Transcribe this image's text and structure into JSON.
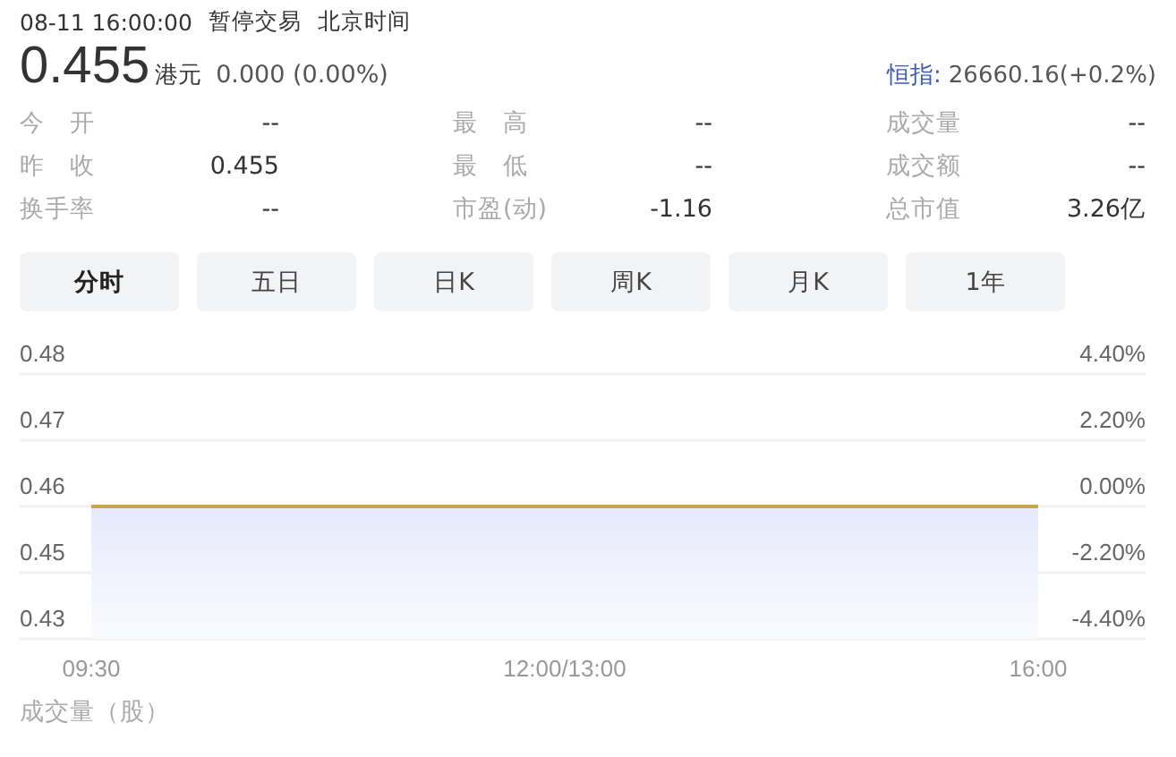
{
  "header": {
    "datetime": "08-11 16:00:00",
    "status": "暂停交易",
    "timezone": "北京时间"
  },
  "quote": {
    "price": "0.455",
    "currency": "港元",
    "change": "0.000 (0.00%)",
    "index_label": "恒指:",
    "index_value": "26660.16(+0.2%)"
  },
  "stats": [
    {
      "label": "今　开",
      "value": "--"
    },
    {
      "label": "最　高",
      "value": "--"
    },
    {
      "label": "成交量",
      "value": "--"
    },
    {
      "label": "昨　收",
      "value": "0.455"
    },
    {
      "label": "最　低",
      "value": "--"
    },
    {
      "label": "成交额",
      "value": "--"
    },
    {
      "label": "换手率",
      "value": "--"
    },
    {
      "label": "市盈(动)",
      "value": "-1.16"
    },
    {
      "label": "总市值",
      "value": "3.26亿"
    }
  ],
  "tabs": [
    {
      "label": "分时",
      "selected": true
    },
    {
      "label": "五日",
      "selected": false
    },
    {
      "label": "日K",
      "selected": false
    },
    {
      "label": "周K",
      "selected": false
    },
    {
      "label": "月K",
      "selected": false
    },
    {
      "label": "1年",
      "selected": false
    }
  ],
  "chart": {
    "right_axis_labels": [
      "4.40%",
      "2.20%",
      "0.00%",
      "-2.20%",
      "-4.40%"
    ],
    "chart_data": {
      "type": "area",
      "categories": [
        "09:30",
        "12:00/13:00",
        "16:00"
      ],
      "series": [
        {
          "color": "#c9a54a",
          "values": [
            0.455,
            0.455,
            0.455
          ]
        }
      ],
      "ylim": [
        0.435,
        0.475
      ],
      "grid": true,
      "yticks": [
        {
          "value": 0.475,
          "label": "0.48"
        },
        {
          "value": 0.465,
          "label": "0.47"
        },
        {
          "value": 0.455,
          "label": "0.46"
        },
        {
          "value": 0.445,
          "label": "0.45"
        },
        {
          "value": 0.435,
          "label": "0.43"
        }
      ]
    }
  },
  "volume": {
    "label": "成交量（股）"
  }
}
